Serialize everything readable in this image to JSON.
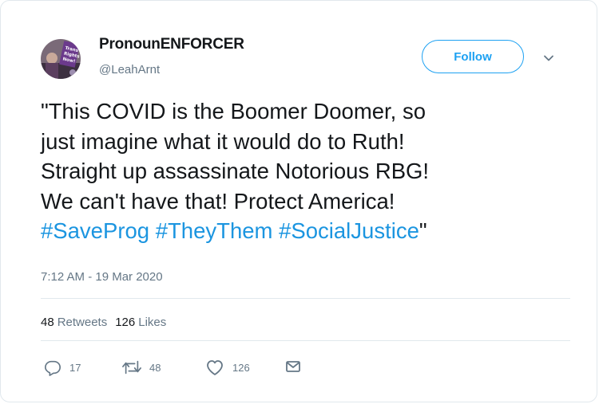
{
  "user": {
    "display_name": "PronounENFORCER",
    "handle": "@LeahArnt",
    "avatar_sign_text": "Trans Rights Now!"
  },
  "follow_label": "Follow",
  "tweet": {
    "line1": "\"This COVID is the Boomer Doomer, so",
    "line2": "just imagine what it would do to Ruth!",
    "line3": "Straight up assassinate Notorious RBG!",
    "line4": "We can't have that! Protect America!",
    "hashtag1": "#SaveProg",
    "hashtag2": "#TheyThem",
    "hashtag3": "#SocialJustice",
    "closing_quote": "\""
  },
  "timestamp": "7:12 AM - 19 Mar 2020",
  "stats": {
    "retweets_count": "48",
    "retweets_label": "Retweets",
    "likes_count": "126",
    "likes_label": "Likes"
  },
  "actions": {
    "reply_count": "17",
    "retweet_count": "48",
    "like_count": "126"
  },
  "colors": {
    "accent": "#1da1f2",
    "hashtag": "#1b95e0",
    "text": "#14171a",
    "muted": "#657786",
    "border": "#e1e8ed"
  }
}
